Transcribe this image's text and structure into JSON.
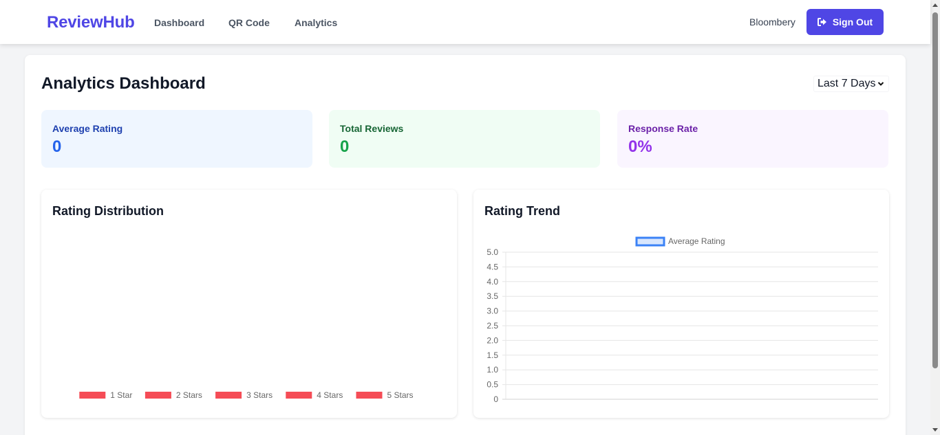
{
  "nav": {
    "brand": "ReviewHub",
    "links": [
      "Dashboard",
      "QR Code",
      "Analytics"
    ],
    "user": "Bloombery",
    "signout_label": "Sign Out"
  },
  "page": {
    "title": "Analytics Dashboard",
    "range_selected": "Last 7 Days"
  },
  "stats": [
    {
      "label": "Average Rating",
      "value": "0"
    },
    {
      "label": "Total Reviews",
      "value": "0"
    },
    {
      "label": "Response Rate",
      "value": "0%"
    }
  ],
  "panels": {
    "distribution_title": "Rating Distribution",
    "trend_title": "Rating Trend"
  },
  "colors": {
    "brand": "#4f46e5",
    "dist_bar": "#f54c56",
    "trend_line": "#3b82f6"
  },
  "chart_data": [
    {
      "type": "bar",
      "categories": [
        "1 Star",
        "2 Stars",
        "3 Stars",
        "4 Stars",
        "5 Stars"
      ],
      "values": [
        0,
        0,
        0,
        0,
        0
      ],
      "legend": [
        "1 Star",
        "2 Stars",
        "3 Stars",
        "4 Stars",
        "5 Stars"
      ],
      "legend_position": "bottom"
    },
    {
      "type": "line",
      "series": [
        {
          "name": "Average Rating",
          "values": []
        }
      ],
      "x": [],
      "ylim": [
        0,
        5
      ],
      "yticks": [
        "5.0",
        "4.5",
        "4.0",
        "3.5",
        "3.0",
        "2.5",
        "2.0",
        "1.5",
        "1.0",
        "0.5",
        "0"
      ],
      "grid": true,
      "legend_position": "top"
    }
  ]
}
